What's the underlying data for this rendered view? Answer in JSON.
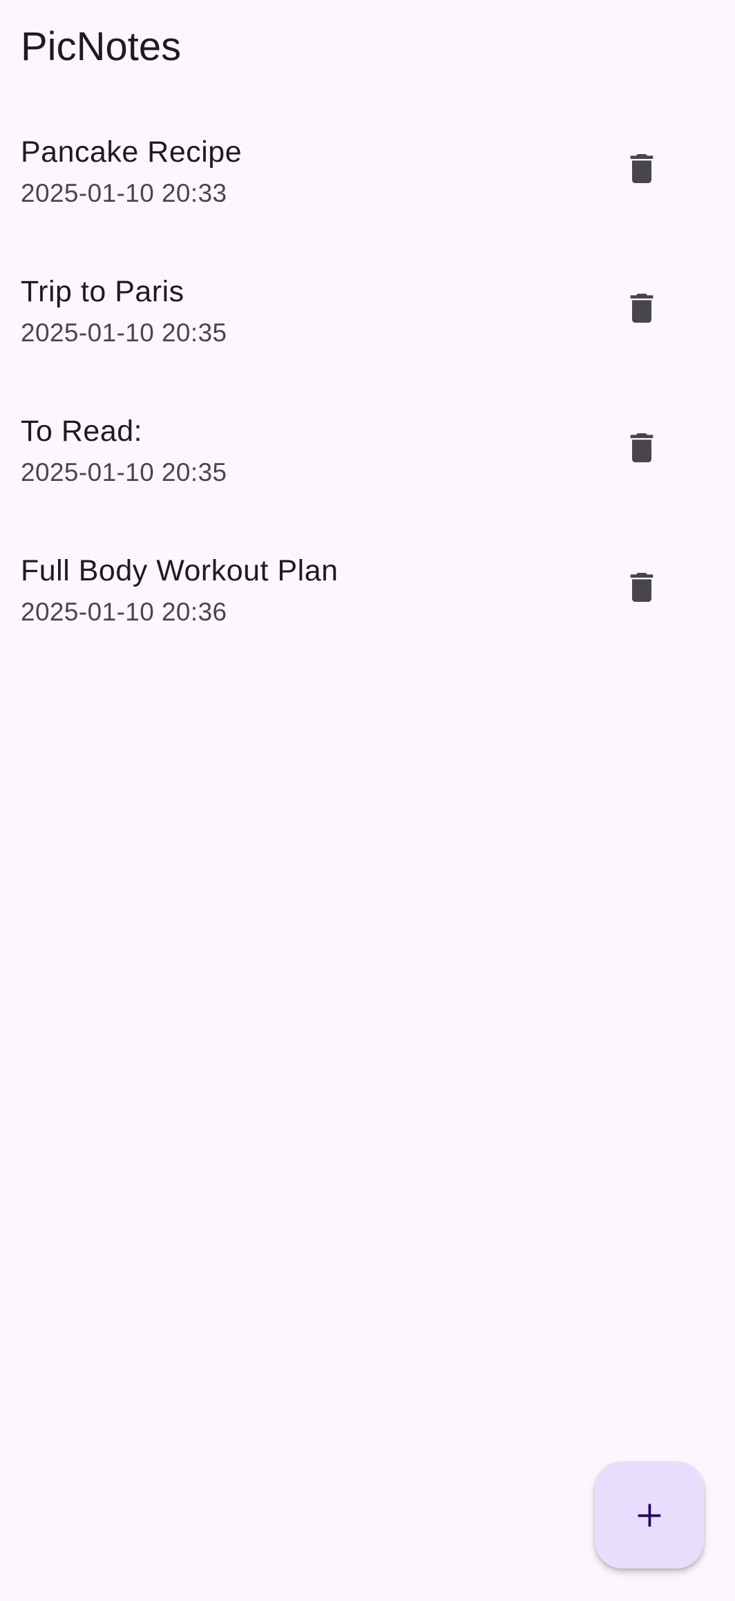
{
  "app": {
    "title": "PicNotes"
  },
  "notes": [
    {
      "title": "Pancake Recipe",
      "date": "2025-01-10 20:33",
      "delete_icon": "trash-icon"
    },
    {
      "title": "Trip to Paris",
      "date": "2025-01-10 20:35",
      "delete_icon": "trash-icon"
    },
    {
      "title": "To Read:",
      "date": "2025-01-10 20:35",
      "delete_icon": "trash-icon"
    },
    {
      "title": "Full Body Workout Plan",
      "date": "2025-01-10 20:36",
      "delete_icon": "trash-icon"
    }
  ],
  "fab": {
    "icon": "plus-icon"
  },
  "colors": {
    "background": "#fdf7fd",
    "text_primary": "#1d1b20",
    "text_secondary": "#49454f",
    "icon": "#49454f",
    "fab_background": "#e9ddfd",
    "fab_icon": "#21005d"
  }
}
